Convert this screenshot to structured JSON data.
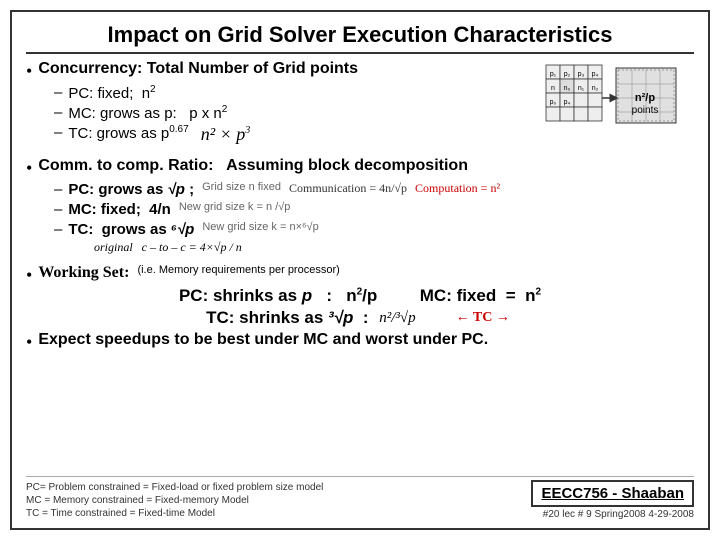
{
  "slide": {
    "title": "Impact on Grid Solver Execution Characteristics",
    "section1": {
      "header": "Concurrency:  Total Number of Grid points",
      "bullets": [
        "PC: fixed;  n²",
        "MC: grows as p:   p x n²",
        "TC: grows as p⁰·⁶⁷"
      ],
      "diagram_label1": "n²/p",
      "diagram_label2": "points"
    },
    "section2": {
      "header": "Comm. to comp. Ratio:   Assuming block decomposition",
      "bullets": [
        {
          "text": "PC: grows as √p ;",
          "note": "Grid size n fixed",
          "formula_comm": "Communication = 4n/√p",
          "formula_comp": "Computation = n²"
        },
        {
          "text": "MC: fixed;  4/n",
          "note": "New grid size k = n/√p",
          "formula": ""
        },
        {
          "text": "TC:  grows as ⁶√p",
          "note": "New grid size k = n×⁶√p",
          "formula": ""
        }
      ],
      "original_note": "original   c – to – c = 4×√p / n"
    },
    "section3": {
      "header": "Working Set:",
      "note": "(i.e. Memory requirements per processor)",
      "pc_line": "PC: shrinks as p  :  n²/p        MC: fixed  =  n²",
      "tc_line": "TC: shrinks as ³√p  :",
      "tc_fraction": "n²/³√p",
      "tc_arrow": "← TC →"
    },
    "section4": {
      "text": "Expect speedups to be best under MC and worst under PC."
    },
    "footer": {
      "left": [
        "PC= Problem constrained =  Fixed-load or fixed problem size model",
        "MC = Memory constrained = Fixed-memory Model",
        "TC = Time constrained =  Fixed-time Model"
      ],
      "right_box": "EECC756 - Shaaban",
      "page": "#20  lec # 9   Spring2008  4-29-2008"
    }
  }
}
